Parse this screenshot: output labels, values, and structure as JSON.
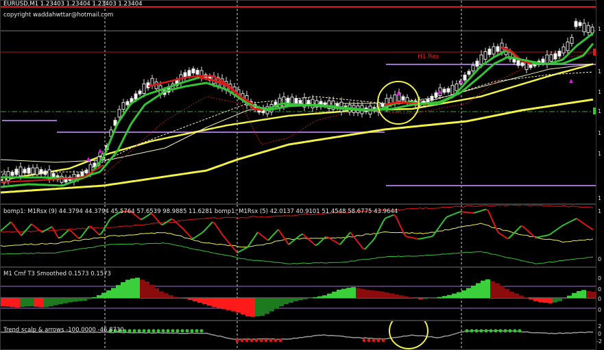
{
  "window": {
    "title": "EURUSD,M1  1.23403 1.23404 1.23403 1.23404",
    "copyright": "copyright waddahwttar@hotmail.com"
  },
  "main": {
    "h1_label": "H1 Res",
    "price_ticks": [
      "1",
      "1",
      "1",
      "1",
      "1",
      "1",
      "1"
    ]
  },
  "indicators": {
    "rsx": {
      "label": "bomp1: M1Rsx (9) 44.3794 44.3794 45.5764 57.6539 98.9885 11.6281  bomp1: M1Rsx (5) 42.0137 40.9101 51.4548 58.6775 43.9644",
      "ticks": [
        "1",
        "0"
      ]
    },
    "cmf": {
      "label": "M1 Cmf T3 Smoothed 0.1573 0.1573",
      "ticks": [
        "0",
        "0",
        "0",
        "0"
      ]
    },
    "trend": {
      "label": "Trend scalp & arrows -100.0000 -46.8730",
      "ticks": [
        "2",
        "0",
        "-2"
      ]
    }
  },
  "colors": {
    "background": "#000000",
    "green": "#35c435",
    "red": "#e01818",
    "yellow": "#f2f24a",
    "white": "#ffffff",
    "magenta": "#d020d0",
    "violet": "#a070d0",
    "darkred": "#8a0c0c",
    "darkgreen": "#1e7a1e"
  }
}
